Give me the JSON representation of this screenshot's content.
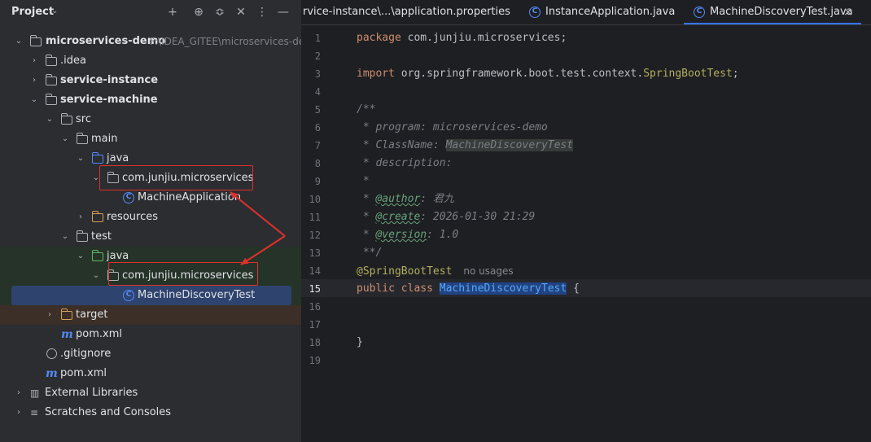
{
  "project_panel": {
    "title": "Project",
    "tree": [
      {
        "label": "microservices-demo",
        "path": "F:\\IDEA_GITEE\\microservices-de",
        "arrow": "⌄",
        "icon": "module-folder"
      },
      {
        "label": ".idea",
        "arrow": "›",
        "icon": "folder"
      },
      {
        "label": "service-instance",
        "arrow": "›",
        "icon": "module-folder"
      },
      {
        "label": "service-machine",
        "arrow": "⌄",
        "icon": "module-folder"
      },
      {
        "label": "src",
        "arrow": "⌄",
        "icon": "folder"
      },
      {
        "label": "main",
        "arrow": "⌄",
        "icon": "folder"
      },
      {
        "label": "java",
        "arrow": "⌄",
        "icon": "source-folder"
      },
      {
        "label": "com.junjiu.microservices",
        "arrow": "⌄",
        "icon": "package"
      },
      {
        "label": "MachineApplication",
        "arrow": "",
        "icon": "spring-class"
      },
      {
        "label": "resources",
        "arrow": "›",
        "icon": "resources-folder"
      },
      {
        "label": "test",
        "arrow": "⌄",
        "icon": "folder"
      },
      {
        "label": "java",
        "arrow": "⌄",
        "icon": "test-folder"
      },
      {
        "label": "com.junjiu.microservices",
        "arrow": "⌄",
        "icon": "package"
      },
      {
        "label": "MachineDiscoveryTest",
        "arrow": "",
        "icon": "class"
      },
      {
        "label": "target",
        "arrow": "›",
        "icon": "excluded-folder"
      },
      {
        "label": "pom.xml",
        "arrow": "",
        "icon": "maven"
      },
      {
        "label": ".gitignore",
        "arrow": "",
        "icon": "gitignore"
      },
      {
        "label": "pom.xml",
        "arrow": "",
        "icon": "maven"
      },
      {
        "label": "External Libraries",
        "arrow": "›",
        "icon": "libraries"
      },
      {
        "label": "Scratches and Consoles",
        "arrow": "›",
        "icon": "scratches"
      }
    ]
  },
  "tabs": [
    {
      "label": "rvice-instance\\...\\application.properties"
    },
    {
      "label": "InstanceApplication.java"
    },
    {
      "label": "MachineDiscoveryTest.java",
      "close": "×"
    }
  ],
  "editor": {
    "line_numbers": [
      "1",
      "2",
      "3",
      "4",
      "5",
      "6",
      "7",
      "8",
      "9",
      "10",
      "11",
      "12",
      "13",
      "14",
      "15",
      "16",
      "17",
      "18",
      "19"
    ],
    "package_kw": "package",
    "package_name": " com.junjiu.microservices;",
    "import_kw": "import",
    "import_path": " org.springframework.boot.test.context.",
    "import_class": "SpringBootTest",
    "import_end": ";",
    "c_open": "/**",
    "c_program": " * program: microservices-demo",
    "c_classname_pre": " * ClassName: ",
    "c_classname": "MachineDiscoveryTest",
    "c_desc": " * description:",
    "c_star": " *",
    "c_author_pre": " * ",
    "c_author_tag": "@author",
    "c_author_val": ": 君九",
    "c_create_pre": " * ",
    "c_create_tag": "@create",
    "c_create_val": ": 2026-01-30 21:29",
    "c_version_pre": " * ",
    "c_version_tag": "@version",
    "c_version_val": ": 1.0",
    "c_close": " **/",
    "annotation": "@SpringBootTest",
    "usage_hint": "no usages",
    "class_kw": "public class",
    "class_name": "MachineDiscoveryTest",
    "class_open": " {",
    "class_close": "}"
  },
  "colors": {
    "highlight_box": "#e0302d",
    "selection": "#2e436e",
    "accent": "#3574f0"
  }
}
